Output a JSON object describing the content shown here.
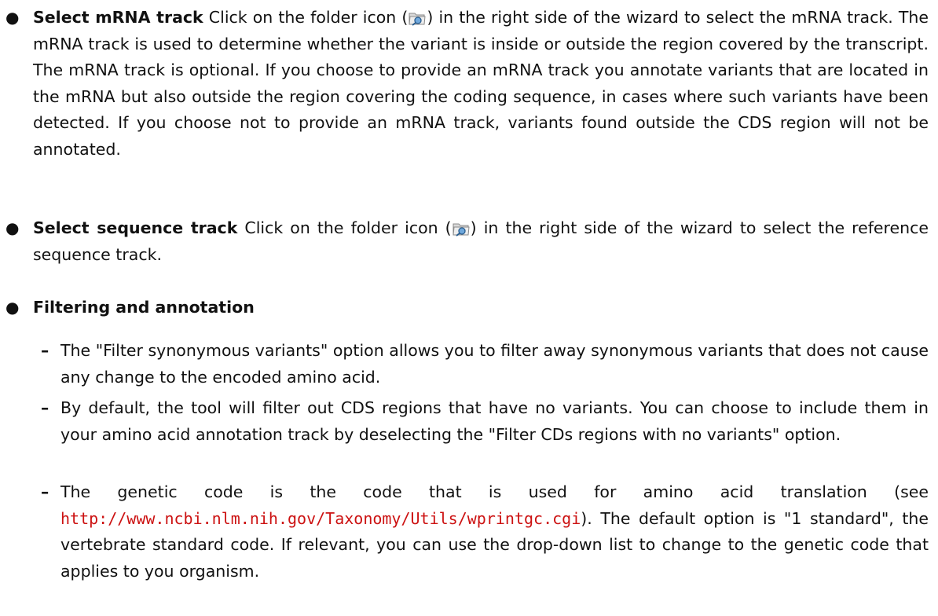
{
  "bullets": [
    {
      "term": "Select mRNA track",
      "text_before_icon": " Click on the folder icon (",
      "text_after_icon": ") in the right side of the wizard to select the mRNA track. The mRNA track is used to determine whether the variant is inside or outside the region covered by the transcript. The mRNA track is optional. If you choose to provide an mRNA track you annotate variants that are located in the mRNA but also outside the region covering the coding sequence, in cases where such variants have been detected. If you choose not to provide an mRNA track, variants found outside the CDS region will not be annotated.",
      "icon": "folder-icon"
    },
    {
      "term": "Select sequence track",
      "text_before_icon": " Click on the folder icon (",
      "text_after_icon": ") in the right side of the wizard to select the reference sequence track.",
      "icon": "folder-icon"
    },
    {
      "term": "Filtering and annotation"
    }
  ],
  "sub_items": [
    {
      "text": "The \"Filter synonymous variants\" option allows you to filter away synonymous variants that does not cause any change to the encoded amino acid."
    },
    {
      "text": "By default, the tool will filter out CDS regions that have no variants. You can choose to include them in your amino acid annotation track by deselecting the \"Filter CDs regions with no variants\" option."
    },
    {
      "text_before_link": "The genetic code is the code that is used for amino acid translation (see ",
      "link": "http://www.ncbi.nlm.nih.gov/Taxonomy/Utils/wprintgc.cgi",
      "text_after_link": "). The default option is \"1 standard\", the vertebrate standard code. If relevant, you can use the drop-down list to change to the genetic code that applies to you organism."
    }
  ],
  "colors": {
    "link": "#cc1111",
    "text": "#111111"
  }
}
